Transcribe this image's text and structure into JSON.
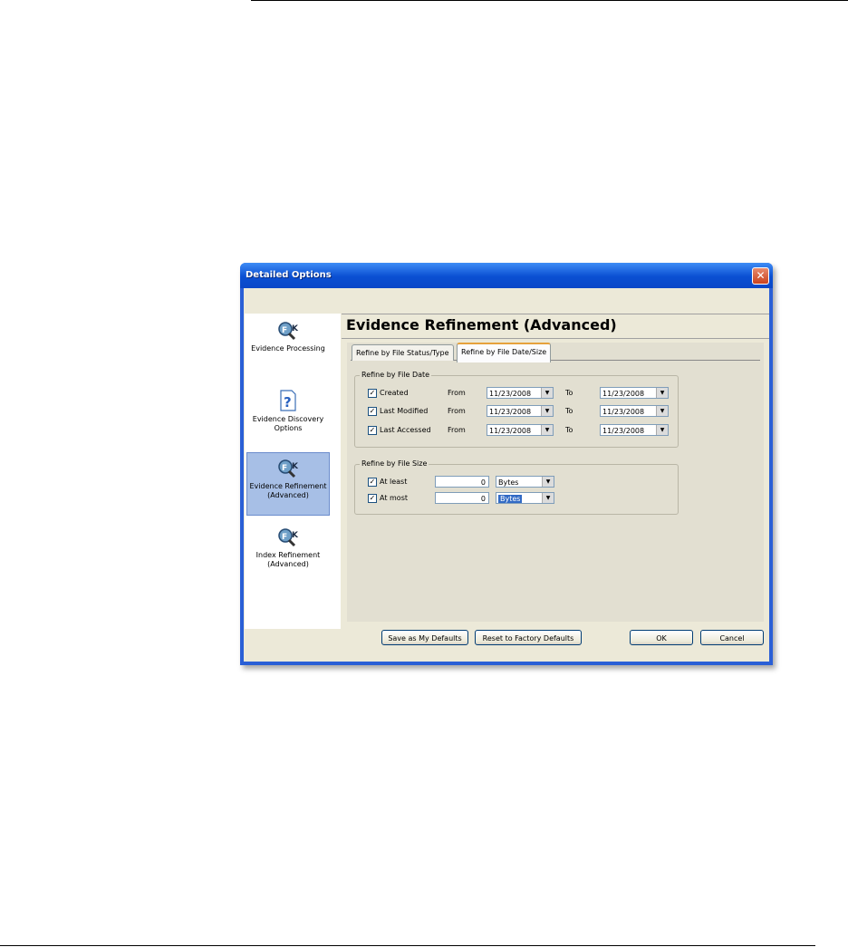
{
  "window": {
    "title": "Detailed Options",
    "close_glyph": "✕"
  },
  "sidebar": {
    "items": [
      {
        "label": "Evidence Processing",
        "icon": "ftk-magnifier-icon",
        "selected": false
      },
      {
        "label": "Evidence Discovery Options",
        "icon": "help-question-icon",
        "selected": false
      },
      {
        "label": "Evidence Refinement (Advanced)",
        "icon": "ftk-magnifier-icon",
        "selected": true
      },
      {
        "label": "Index Refinement (Advanced)",
        "icon": "ftk-magnifier-icon",
        "selected": false
      }
    ]
  },
  "main": {
    "heading": "Evidence Refinement (Advanced)",
    "tabs": [
      {
        "label": "Refine by File Status/Type",
        "active": false
      },
      {
        "label": "Refine by File Date/Size",
        "active": true
      }
    ],
    "date_group": {
      "legend": "Refine by File Date",
      "rows": [
        {
          "checked": true,
          "label": "Created",
          "from_label": "From",
          "from": "11/23/2008",
          "to_label": "To",
          "to": "11/23/2008"
        },
        {
          "checked": true,
          "label": "Last Modified",
          "from_label": "From",
          "from": "11/23/2008",
          "to_label": "To",
          "to": "11/23/2008"
        },
        {
          "checked": true,
          "label": "Last Accessed",
          "from_label": "From",
          "from": "11/23/2008",
          "to_label": "To",
          "to": "11/23/2008"
        }
      ]
    },
    "size_group": {
      "legend": "Refine by File Size",
      "rows": [
        {
          "checked": true,
          "label": "At least",
          "value": "0",
          "unit": "Bytes"
        },
        {
          "checked": true,
          "label": "At most",
          "value": "0",
          "unit": "Bytes"
        }
      ]
    }
  },
  "footer": {
    "save_defaults": "Save as My Defaults",
    "reset_defaults": "Reset to Factory Defaults",
    "ok": "OK",
    "cancel": "Cancel"
  },
  "colors": {
    "titlebar": "#0a4fd2",
    "selected_nav": "#a7bfe6",
    "dialog_bg": "#ece9d8"
  }
}
